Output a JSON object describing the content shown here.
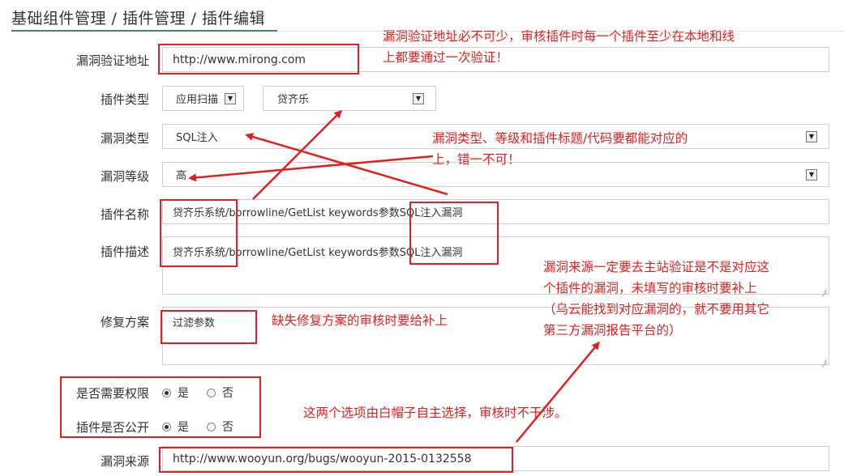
{
  "breadcrumb": "基础组件管理 / 插件管理 / 插件编辑",
  "fields": {
    "verify_url": {
      "label": "漏洞验证地址",
      "value": "http://www.mirong.com"
    },
    "plugin_type": {
      "label": "插件类型",
      "type_value": "应用扫描",
      "app_value": "贷齐乐"
    },
    "vuln_type": {
      "label": "漏洞类型",
      "value": "SQL注入"
    },
    "vuln_level": {
      "label": "漏洞等级",
      "value": "高"
    },
    "plugin_name": {
      "label": "插件名称",
      "value": "贷齐乐系统/borrowline/GetList keywords参数SQL注入漏洞"
    },
    "plugin_desc": {
      "label": "插件描述",
      "value": "贷齐乐系统/borrowline/GetList keywords参数SQL注入漏洞"
    },
    "fix": {
      "label": "修复方案",
      "value": "过滤参数"
    },
    "need_auth": {
      "label": "是否需要权限",
      "yes": "是",
      "no": "否",
      "selected": "是"
    },
    "is_public": {
      "label": "插件是否公开",
      "yes": "是",
      "no": "否",
      "selected": "是"
    },
    "source": {
      "label": "漏洞来源",
      "value": "http://www.wooyun.org/bugs/wooyun-2015-0132558"
    }
  },
  "annotations": {
    "verify_note_1": "漏洞验证地址必不可少，审核插件时每一个插件至少在本地和线",
    "verify_note_2": "上都要通过一次验证！",
    "type_note_1": "漏洞类型、等级和插件标题/代码要都能对应的",
    "type_note_2": "上，错一不可！",
    "fix_note": "缺失修复方案的审核时要给补上",
    "source_note_1": "漏洞来源一定要去主站验证是不是对应这",
    "source_note_2": "个插件的漏洞，未填写的审核时要补上",
    "source_note_3": "（乌云能找到对应漏洞的，就不要用其它",
    "source_note_4": "第三方漏洞报告平台的）",
    "options_note": "这两个选项由白帽子自主选择，审核时不干涉。"
  },
  "colors": {
    "annotation": "#e02020",
    "accent": "#3a8f5c"
  }
}
